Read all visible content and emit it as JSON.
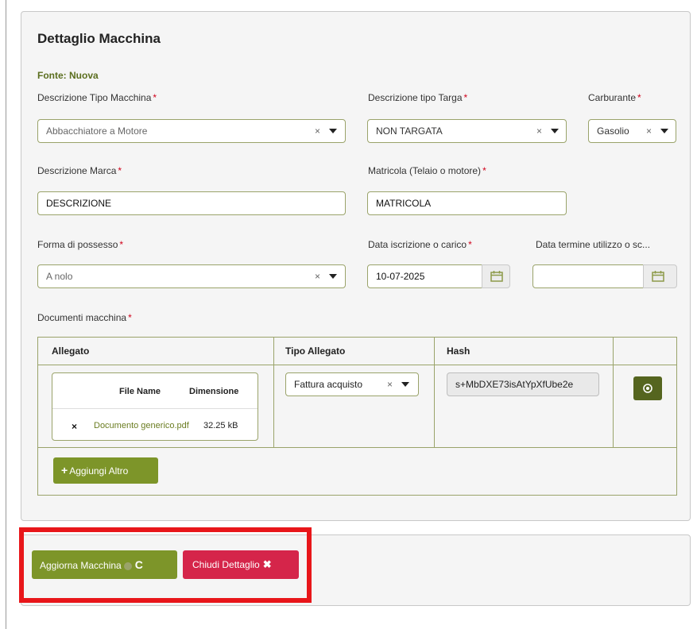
{
  "panel": {
    "title": "Dettaglio Macchina",
    "fonte": "Fonte: Nuova"
  },
  "fields": {
    "tipo_macchina": {
      "label": "Descrizione Tipo Macchina",
      "value": "Abbacchiatore a Motore"
    },
    "tipo_targa": {
      "label": "Descrizione tipo Targa",
      "value": "NON TARGATA"
    },
    "carburante": {
      "label": "Carburante",
      "value": "Gasolio"
    },
    "marca": {
      "label": "Descrizione Marca",
      "value": "DESCRIZIONE"
    },
    "matricola": {
      "label": "Matricola (Telaio o motore)",
      "value": "MATRICOLA"
    },
    "forma_possesso": {
      "label": "Forma di possesso",
      "value": "A nolo"
    },
    "data_iscrizione": {
      "label": "Data iscrizione o carico",
      "value": "10-07-2025"
    },
    "data_termine": {
      "label": "Data termine utilizzo o sc...",
      "value": ""
    }
  },
  "required_mark": "*",
  "clear_glyph": "×",
  "documenti": {
    "label": "Documenti macchina",
    "columns": [
      "Allegato",
      "Tipo Allegato",
      "Hash"
    ],
    "inner_columns": [
      "File Name",
      "Dimensione"
    ],
    "row": {
      "delete_glyph": "×",
      "file_name": "Documento generico.pdf",
      "size": "32.25 kB",
      "tipo": "Fattura acquisto",
      "hash": "s+MbDXE73isAtYpXfUbe2e"
    },
    "add_label": "Aggiungi Altro",
    "add_icon": "+"
  },
  "actions": {
    "update_label": "Aggiorna Macchina",
    "update_icon": "C",
    "close_label": "Chiudi Dettaglio",
    "close_icon": "✖"
  },
  "colors": {
    "accent_green": "#7d9529",
    "dark_green": "#55651f",
    "danger": "#d5254a",
    "highlight": "#e8161a"
  }
}
